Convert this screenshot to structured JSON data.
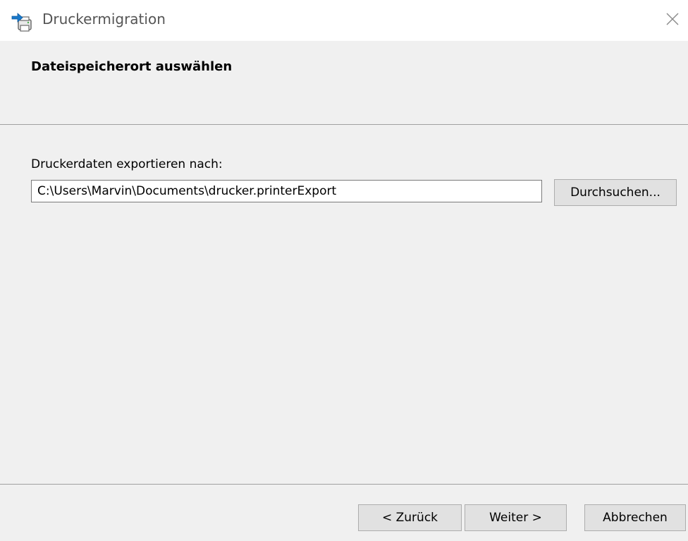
{
  "window": {
    "title": "Druckermigration",
    "app_icon": "printer-migration-icon",
    "close_icon": "close-icon"
  },
  "header": {
    "title": "Dateispeicherort auswählen"
  },
  "export": {
    "label": "Druckerdaten exportieren nach:",
    "path_value": "C:\\Users\\Marvin\\Documents\\drucker.printerExport",
    "browse_label": "Durchsuchen..."
  },
  "footer": {
    "back_label": "< Zurück",
    "next_label": "Weiter >",
    "cancel_label": "Abbrechen"
  },
  "colors": {
    "background": "#f0f0f0",
    "titlebar": "#ffffff",
    "button_face": "#e1e1e1",
    "accent_blue": "#1979ca"
  }
}
